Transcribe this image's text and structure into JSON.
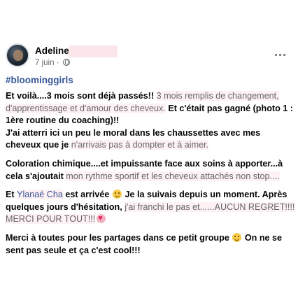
{
  "post": {
    "author": "Adeline C",
    "date": "7 juin",
    "separator": "·",
    "hashtag": "#bloominggirls",
    "paragraphs": {
      "p1": [
        {
          "t": "Et voilà....3 mois sont déjà passés!! ",
          "s": "b"
        },
        {
          "t": "3 mois remplis de changement, d'apprentissage et d'amour des cheveux.",
          "s": "l"
        },
        {
          "t": " Et c'était pas gagné (photo 1 : 1ère routine du coaching)!!",
          "s": "b"
        }
      ],
      "p1b": [
        {
          "t": "J'ai atterri ici un peu le moral dans les chaussettes avec mes cheveux que je ",
          "s": "b"
        },
        {
          "t": "n'arrivais pas à dompter et à aimer.",
          "s": "l"
        }
      ],
      "p2": [
        {
          "t": "Coloration chimique....et impuissante face aux soins à apporter...à cela s'ajoutait ",
          "s": "b"
        },
        {
          "t": "mon rythme sportif et les cheveux attachés non stop....",
          "s": "l"
        }
      ],
      "p3": [
        {
          "t": "Et ",
          "s": "b"
        },
        {
          "t": "Ylanaé Cha",
          "s": "m"
        },
        {
          "t": " est arrivée ",
          "s": "b"
        },
        {
          "t": "",
          "s": "emoji"
        },
        {
          "t": " Je la suivais depuis un moment. Après quelques jours d'hésitation, ",
          "s": "b"
        },
        {
          "t": "j'ai franchi le pas et......AUCUN REGRET!!!! MERCI POUR TOUT!!!",
          "s": "l"
        },
        {
          "t": "",
          "s": "heart"
        }
      ],
      "p4": [
        {
          "t": "Merci à toutes pour les partages dans ce petit groupe ",
          "s": "b"
        },
        {
          "t": "",
          "s": "emoji"
        },
        {
          "t": " On ne se sent pas seule et ça c'est cool!!!",
          "s": "b"
        }
      ]
    }
  },
  "icons": {
    "privacy": "globe-icon",
    "menu": "more-horizontal-icon",
    "emoji": "smiling-face-icon",
    "heart": "heart-icon"
  },
  "colors": {
    "link": "#385898",
    "secondary_text": "#65676b",
    "primary_text": "#050505"
  }
}
